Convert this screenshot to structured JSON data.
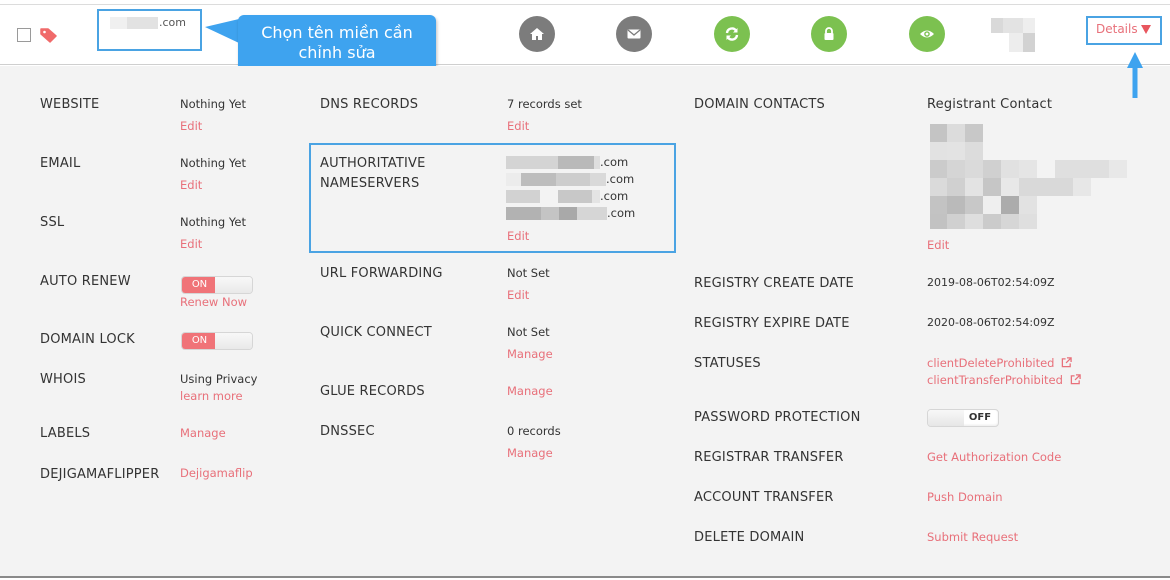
{
  "header": {
    "domain_suffix": ".com",
    "callout_text": "Chọn tên miền cần chỉnh sửa",
    "icons": [
      {
        "name": "home-icon",
        "color": "#7c7c7c"
      },
      {
        "name": "email-icon",
        "color": "#7c7c7c"
      },
      {
        "name": "refresh-icon",
        "color": "#7cc150"
      },
      {
        "name": "lock-icon",
        "color": "#7cc150"
      },
      {
        "name": "eye-icon",
        "color": "#7cc150"
      }
    ],
    "details_label": "Details"
  },
  "colors": {
    "accent_link": "#e8707a",
    "highlight_border": "#4aa3e3",
    "toggle_on": "#f07378",
    "icon_gray": "#7c7c7c",
    "icon_green": "#7cc150",
    "panel_bg": "#f3f3f3"
  },
  "col1": {
    "website": {
      "label": "WEBSITE",
      "value": "Nothing Yet",
      "action": "Edit"
    },
    "email": {
      "label": "EMAIL",
      "value": "Nothing Yet",
      "action": "Edit"
    },
    "ssl": {
      "label": "SSL",
      "value": "Nothing Yet",
      "action": "Edit"
    },
    "auto_renew": {
      "label": "AUTO RENEW",
      "toggle": "ON",
      "action": "Renew Now"
    },
    "domain_lock": {
      "label": "DOMAIN LOCK",
      "toggle": "ON"
    },
    "whois": {
      "label": "WHOIS",
      "value": "Using Privacy",
      "action": "learn more"
    },
    "labels": {
      "label": "LABELS",
      "action": "Manage"
    },
    "flipper": {
      "label": "DEJIGAMAFLIPPER",
      "action": "Dejigamaflip"
    }
  },
  "col2": {
    "dns_records": {
      "label": "DNS RECORDS",
      "value": "7 records set",
      "action": "Edit"
    },
    "nameservers": {
      "label_line1": "AUTHORITATIVE",
      "label_line2": "NAMESERVERS",
      "values": [
        ".com",
        ".com",
        ".com",
        ".com"
      ],
      "action": "Edit"
    },
    "url_forwarding": {
      "label": "URL FORWARDING",
      "value": "Not Set",
      "action": "Edit"
    },
    "quick_connect": {
      "label": "QUICK CONNECT",
      "value": "Not Set",
      "action": "Manage"
    },
    "glue_records": {
      "label": "GLUE RECORDS",
      "action": "Manage"
    },
    "dnssec": {
      "label": "DNSSEC",
      "value": "0 records",
      "action": "Manage"
    }
  },
  "col3": {
    "domain_contacts": {
      "label": "DOMAIN CONTACTS",
      "value": "Registrant Contact",
      "action": "Edit"
    },
    "create_date": {
      "label": "REGISTRY CREATE DATE",
      "value": "2019-08-06T02:54:09Z"
    },
    "expire_date": {
      "label": "REGISTRY EXPIRE DATE",
      "value": "2020-08-06T02:54:09Z"
    },
    "statuses": {
      "label": "STATUSES",
      "values": [
        "clientDeleteProhibited",
        "clientTransferProhibited"
      ]
    },
    "password_protection": {
      "label": "PASSWORD PROTECTION",
      "toggle": "OFF"
    },
    "registrar_transfer": {
      "label": "REGISTRAR TRANSFER",
      "action": "Get Authorization Code"
    },
    "account_transfer": {
      "label": "ACCOUNT TRANSFER",
      "action": "Push Domain"
    },
    "delete_domain": {
      "label": "DELETE DOMAIN",
      "action": "Submit Request"
    }
  }
}
